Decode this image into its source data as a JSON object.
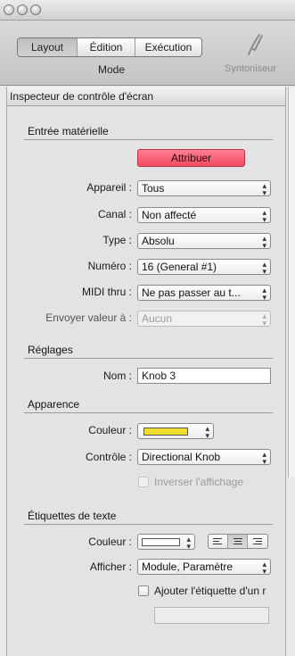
{
  "toolbar": {
    "tabs": [
      {
        "label": "Layout",
        "active": true
      },
      {
        "label": "Édition",
        "active": false
      },
      {
        "label": "Exécution",
        "active": false
      }
    ],
    "mode_label": "Mode",
    "tuner_label": "Syntoniseur",
    "tuner_icon": "tuning-fork-icon"
  },
  "inspector": {
    "header": "Inspecteur de contrôle d'écran",
    "hardware": {
      "title": "Entrée matérielle",
      "assign_button": "Attribuer",
      "assign_color": "#f24a61",
      "device_label": "Appareil :",
      "device_value": "Tous",
      "channel_label": "Canal :",
      "channel_value": "Non affecté",
      "type_label": "Type :",
      "type_value": "Absolu",
      "number_label": "Numéro :",
      "number_value": "16 (General #1)",
      "midi_thru_label": "MIDI thru :",
      "midi_thru_value": "Ne pas passer au t...",
      "send_value_label": "Envoyer valeur à :",
      "send_value_value": "Aucun"
    },
    "settings": {
      "title": "Réglages",
      "name_label": "Nom :",
      "name_value": "Knob 3"
    },
    "appearance": {
      "title": "Apparence",
      "color_label": "Couleur :",
      "color_value": "#f0dc2a",
      "control_label": "Contrôle :",
      "control_value": "Directional Knob",
      "invert_label": "Inverser l'affichage",
      "invert_checked": false
    },
    "text_labels": {
      "title": "Étiquettes de texte",
      "color_label": "Couleur :",
      "color_value": "#ffffff",
      "alignment_active": "center",
      "show_label": "Afficher :",
      "show_value": "Module, Paramètre",
      "add_label_text": "Ajouter l'étiquette d'un r",
      "add_label_checked": false,
      "add_label_field": ""
    }
  }
}
